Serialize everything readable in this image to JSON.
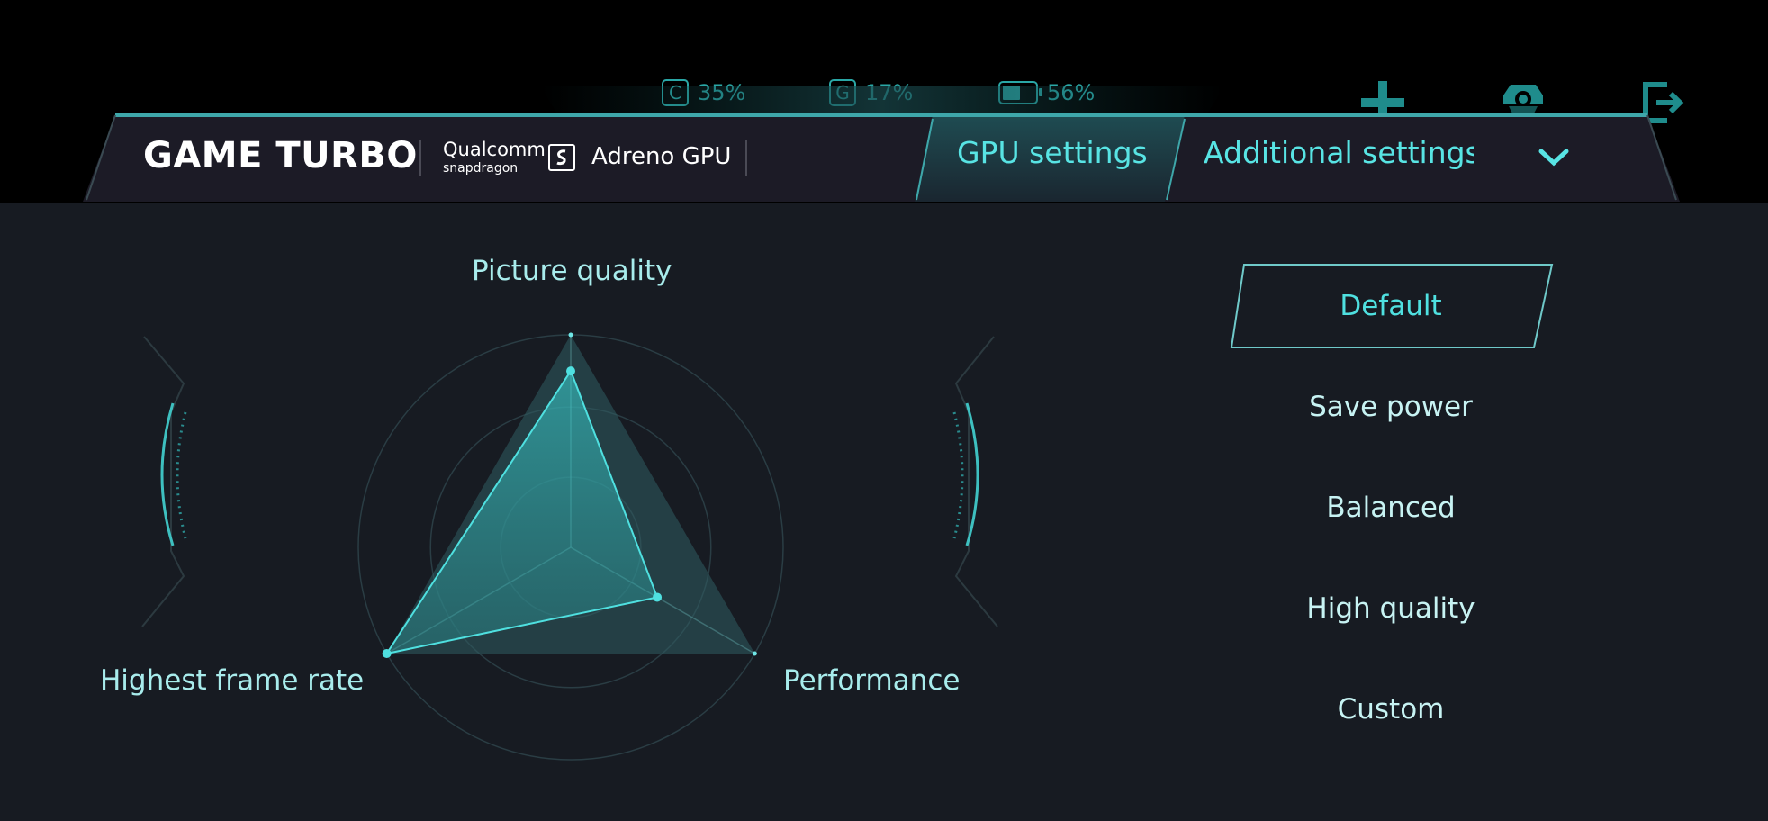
{
  "status": {
    "cpu_letter": "C",
    "cpu_value": "35%",
    "gpu_letter": "G",
    "gpu_value": "17%",
    "battery_value": "56%",
    "battery_level": 0.56
  },
  "header": {
    "title": "GAME TURBO",
    "chip_brand": "Qualcomm",
    "chip_sub": "snapdragon",
    "gpu_name": "Adreno GPU",
    "tabs": [
      {
        "label": "GPU settings",
        "active": true
      },
      {
        "label": "Additional settings",
        "active": false
      }
    ]
  },
  "radar": {
    "axes": [
      {
        "label": "Picture quality",
        "value": 0.83
      },
      {
        "label": "Performance",
        "value": 0.47
      },
      {
        "label": "Highest frame rate",
        "value": 1.0
      }
    ]
  },
  "modes": {
    "selected": "Default",
    "options": [
      "Default",
      "Save power",
      "Balanced",
      "High quality",
      "Custom"
    ]
  },
  "colors": {
    "accent": "#4fe0e0",
    "panel": "#171b22",
    "header": "#1c1b26"
  }
}
